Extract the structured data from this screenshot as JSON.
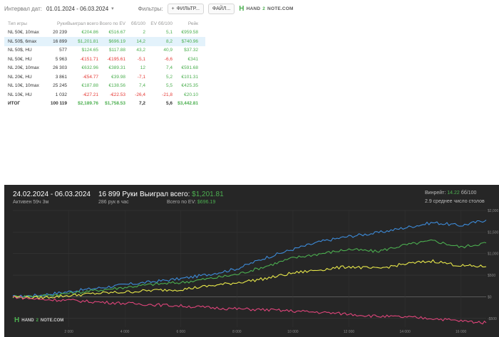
{
  "topbar": {
    "interval_label": "Интервал дат:",
    "date_range": "01.01.2024 - 06.03.2024",
    "filters_label": "Фильтры:",
    "filters_button": "ФИЛЬТР...",
    "files_button": "ФАЙЛ...",
    "brand_pre": "HAND",
    "brand_two": "2",
    "brand_post": "NOTE.COM"
  },
  "table": {
    "headers": [
      "Тип игры",
      "Руки",
      "Выиграл всего",
      "Всего по EV",
      "бб/100",
      "EV бб/100",
      "Рейк"
    ],
    "rows": [
      {
        "game": "NL 50€, 10max",
        "hands": "20 239",
        "won": "€204.86",
        "ev": "€516.67",
        "bb": "2",
        "evbb": "5,1",
        "rake": "€959.58"
      },
      {
        "game": "NL 50$, 6max",
        "hands": "16 899",
        "won": "$1,201.81",
        "ev": "$696.19",
        "bb": "14,2",
        "evbb": "8,2",
        "rake": "$740.96"
      },
      {
        "game": "NL 50$, HU",
        "hands": "577",
        "won": "$124.65",
        "ev": "$117.88",
        "bb": "43,2",
        "evbb": "40,9",
        "rake": "$37.32"
      },
      {
        "game": "NL 50€, HU",
        "hands": "5 963",
        "won": "-€151.71",
        "ev": "-€195.61",
        "bb": "-5,1",
        "evbb": "-6,6",
        "rake": "€341"
      },
      {
        "game": "NL 20€, 10max",
        "hands": "26 303",
        "won": "€632.96",
        "ev": "€389.31",
        "bb": "12",
        "evbb": "7,4",
        "rake": "€591.68"
      },
      {
        "game": "NL 20€, HU",
        "hands": "3 861",
        "won": "-€54.77",
        "ev": "€39.98",
        "bb": "-7,1",
        "evbb": "5,2",
        "rake": "€101.31"
      },
      {
        "game": "NL 10€, 10max",
        "hands": "25 245",
        "won": "€187.88",
        "ev": "€138.56",
        "bb": "7,4",
        "evbb": "5,5",
        "rake": "€425.35"
      },
      {
        "game": "NL 10€, HU",
        "hands": "1 032",
        "won": "-€27.21",
        "ev": "-€22.53",
        "bb": "-26,4",
        "evbb": "-21,8",
        "rake": "€20.10"
      }
    ],
    "total": {
      "game": "ИТОГ",
      "hands": "100 119",
      "won": "$2,189.76",
      "ev": "$1,758.53",
      "bb": "7,2",
      "evbb": "5,6",
      "rake": "$3,442.81"
    }
  },
  "panel": {
    "date_range": "24.02.2024 - 06.03.2024",
    "active": "Активен 59ч 3м",
    "hands": "16 899 Руки",
    "rate": "286 рук в час",
    "won_label": "Выиграл всего:",
    "won_value": "$1,201.81",
    "ev_label": "Всего по EV:",
    "ev_value": "$696.19",
    "winrate_label": "Винрейт:",
    "winrate_value": "14.22",
    "winrate_unit": "бб/100",
    "tables": "2.9 среднее число столов",
    "watermark_pre": "HAND",
    "watermark_two": "2",
    "watermark_post": "NOTE.COM"
  },
  "chart_data": {
    "type": "line",
    "x_ticks": [
      "2 000",
      "4 000",
      "6 000",
      "8 000",
      "10 000",
      "12 000",
      "14 000",
      "16 000"
    ],
    "y_ticks": [
      "$2,000",
      "$1,500",
      "$1,000",
      "$500",
      "$0",
      "-$500"
    ],
    "xlim": [
      0,
      16899
    ],
    "ylim": [
      -700,
      2000
    ],
    "grid": true,
    "series": [
      {
        "color": "#3d8bd9",
        "x": [
          0,
          1000,
          2000,
          3000,
          4000,
          5000,
          6000,
          7000,
          8000,
          9000,
          10000,
          11000,
          12000,
          13000,
          14000,
          15000,
          16000,
          16899
        ],
        "y": [
          0,
          40,
          120,
          200,
          280,
          350,
          420,
          520,
          650,
          900,
          1100,
          1280,
          1400,
          1480,
          1600,
          1720,
          1650,
          1780
        ]
      },
      {
        "color": "#4caf50",
        "x": [
          0,
          1000,
          2000,
          3000,
          4000,
          5000,
          6000,
          7000,
          8000,
          9000,
          10000,
          11000,
          12000,
          13000,
          14000,
          15000,
          16000,
          16899
        ],
        "y": [
          0,
          20,
          80,
          150,
          220,
          290,
          330,
          420,
          520,
          700,
          900,
          1000,
          1100,
          1050,
          1200,
          1300,
          1150,
          1250
        ]
      },
      {
        "color": "#e8e84a",
        "x": [
          0,
          1000,
          2000,
          3000,
          4000,
          5000,
          6000,
          7000,
          8000,
          9000,
          10000,
          11000,
          12000,
          13000,
          14000,
          15000,
          16000,
          16899
        ],
        "y": [
          0,
          -20,
          30,
          80,
          110,
          150,
          170,
          250,
          330,
          420,
          550,
          630,
          700,
          650,
          760,
          830,
          720,
          700
        ]
      },
      {
        "color": "#e0457b",
        "x": [
          0,
          1000,
          2000,
          3000,
          4000,
          5000,
          6000,
          7000,
          8000,
          9000,
          10000,
          11000,
          12000,
          13000,
          14000,
          15000,
          16000,
          16899
        ],
        "y": [
          0,
          -60,
          -80,
          -120,
          -150,
          -180,
          -210,
          -250,
          -280,
          -300,
          -330,
          -360,
          -400,
          -450,
          -470,
          -500,
          -560,
          -600
        ]
      }
    ]
  }
}
